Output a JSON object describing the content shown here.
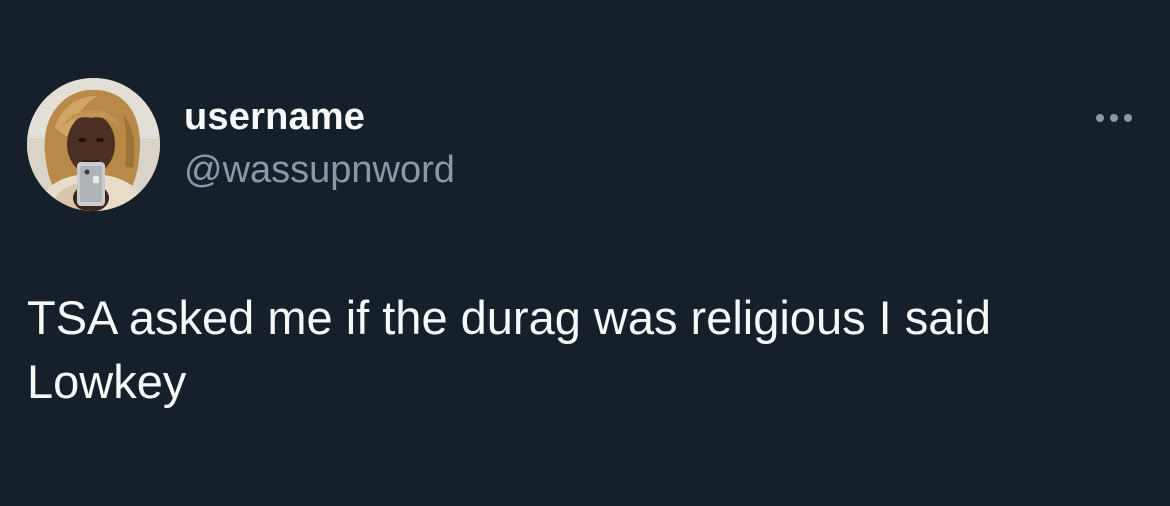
{
  "tweet": {
    "author": {
      "display_name": "username",
      "handle": "@wassupnword",
      "avatar": "profile-photo"
    },
    "more_icon": "more-horizontal-icon",
    "text": "TSA asked me if the durag was religious I said\nLowkey"
  },
  "colors": {
    "background": "#15202b",
    "primary_text": "#f7f9f9",
    "secondary_text": "#8b98a5"
  }
}
